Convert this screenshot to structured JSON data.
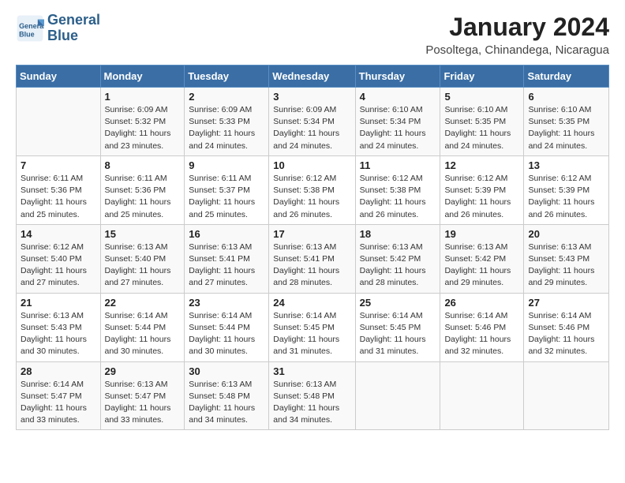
{
  "logo": {
    "line1": "General",
    "line2": "Blue"
  },
  "title": "January 2024",
  "subtitle": "Posoltega, Chinandega, Nicaragua",
  "header_days": [
    "Sunday",
    "Monday",
    "Tuesday",
    "Wednesday",
    "Thursday",
    "Friday",
    "Saturday"
  ],
  "weeks": [
    [
      {
        "day": "",
        "sunrise": "",
        "sunset": "",
        "daylight": ""
      },
      {
        "day": "1",
        "sunrise": "Sunrise: 6:09 AM",
        "sunset": "Sunset: 5:32 PM",
        "daylight": "Daylight: 11 hours and 23 minutes."
      },
      {
        "day": "2",
        "sunrise": "Sunrise: 6:09 AM",
        "sunset": "Sunset: 5:33 PM",
        "daylight": "Daylight: 11 hours and 24 minutes."
      },
      {
        "day": "3",
        "sunrise": "Sunrise: 6:09 AM",
        "sunset": "Sunset: 5:34 PM",
        "daylight": "Daylight: 11 hours and 24 minutes."
      },
      {
        "day": "4",
        "sunrise": "Sunrise: 6:10 AM",
        "sunset": "Sunset: 5:34 PM",
        "daylight": "Daylight: 11 hours and 24 minutes."
      },
      {
        "day": "5",
        "sunrise": "Sunrise: 6:10 AM",
        "sunset": "Sunset: 5:35 PM",
        "daylight": "Daylight: 11 hours and 24 minutes."
      },
      {
        "day": "6",
        "sunrise": "Sunrise: 6:10 AM",
        "sunset": "Sunset: 5:35 PM",
        "daylight": "Daylight: 11 hours and 24 minutes."
      }
    ],
    [
      {
        "day": "7",
        "sunrise": "Sunrise: 6:11 AM",
        "sunset": "Sunset: 5:36 PM",
        "daylight": "Daylight: 11 hours and 25 minutes."
      },
      {
        "day": "8",
        "sunrise": "Sunrise: 6:11 AM",
        "sunset": "Sunset: 5:36 PM",
        "daylight": "Daylight: 11 hours and 25 minutes."
      },
      {
        "day": "9",
        "sunrise": "Sunrise: 6:11 AM",
        "sunset": "Sunset: 5:37 PM",
        "daylight": "Daylight: 11 hours and 25 minutes."
      },
      {
        "day": "10",
        "sunrise": "Sunrise: 6:12 AM",
        "sunset": "Sunset: 5:38 PM",
        "daylight": "Daylight: 11 hours and 26 minutes."
      },
      {
        "day": "11",
        "sunrise": "Sunrise: 6:12 AM",
        "sunset": "Sunset: 5:38 PM",
        "daylight": "Daylight: 11 hours and 26 minutes."
      },
      {
        "day": "12",
        "sunrise": "Sunrise: 6:12 AM",
        "sunset": "Sunset: 5:39 PM",
        "daylight": "Daylight: 11 hours and 26 minutes."
      },
      {
        "day": "13",
        "sunrise": "Sunrise: 6:12 AM",
        "sunset": "Sunset: 5:39 PM",
        "daylight": "Daylight: 11 hours and 26 minutes."
      }
    ],
    [
      {
        "day": "14",
        "sunrise": "Sunrise: 6:12 AM",
        "sunset": "Sunset: 5:40 PM",
        "daylight": "Daylight: 11 hours and 27 minutes."
      },
      {
        "day": "15",
        "sunrise": "Sunrise: 6:13 AM",
        "sunset": "Sunset: 5:40 PM",
        "daylight": "Daylight: 11 hours and 27 minutes."
      },
      {
        "day": "16",
        "sunrise": "Sunrise: 6:13 AM",
        "sunset": "Sunset: 5:41 PM",
        "daylight": "Daylight: 11 hours and 27 minutes."
      },
      {
        "day": "17",
        "sunrise": "Sunrise: 6:13 AM",
        "sunset": "Sunset: 5:41 PM",
        "daylight": "Daylight: 11 hours and 28 minutes."
      },
      {
        "day": "18",
        "sunrise": "Sunrise: 6:13 AM",
        "sunset": "Sunset: 5:42 PM",
        "daylight": "Daylight: 11 hours and 28 minutes."
      },
      {
        "day": "19",
        "sunrise": "Sunrise: 6:13 AM",
        "sunset": "Sunset: 5:42 PM",
        "daylight": "Daylight: 11 hours and 29 minutes."
      },
      {
        "day": "20",
        "sunrise": "Sunrise: 6:13 AM",
        "sunset": "Sunset: 5:43 PM",
        "daylight": "Daylight: 11 hours and 29 minutes."
      }
    ],
    [
      {
        "day": "21",
        "sunrise": "Sunrise: 6:13 AM",
        "sunset": "Sunset: 5:43 PM",
        "daylight": "Daylight: 11 hours and 30 minutes."
      },
      {
        "day": "22",
        "sunrise": "Sunrise: 6:14 AM",
        "sunset": "Sunset: 5:44 PM",
        "daylight": "Daylight: 11 hours and 30 minutes."
      },
      {
        "day": "23",
        "sunrise": "Sunrise: 6:14 AM",
        "sunset": "Sunset: 5:44 PM",
        "daylight": "Daylight: 11 hours and 30 minutes."
      },
      {
        "day": "24",
        "sunrise": "Sunrise: 6:14 AM",
        "sunset": "Sunset: 5:45 PM",
        "daylight": "Daylight: 11 hours and 31 minutes."
      },
      {
        "day": "25",
        "sunrise": "Sunrise: 6:14 AM",
        "sunset": "Sunset: 5:45 PM",
        "daylight": "Daylight: 11 hours and 31 minutes."
      },
      {
        "day": "26",
        "sunrise": "Sunrise: 6:14 AM",
        "sunset": "Sunset: 5:46 PM",
        "daylight": "Daylight: 11 hours and 32 minutes."
      },
      {
        "day": "27",
        "sunrise": "Sunrise: 6:14 AM",
        "sunset": "Sunset: 5:46 PM",
        "daylight": "Daylight: 11 hours and 32 minutes."
      }
    ],
    [
      {
        "day": "28",
        "sunrise": "Sunrise: 6:14 AM",
        "sunset": "Sunset: 5:47 PM",
        "daylight": "Daylight: 11 hours and 33 minutes."
      },
      {
        "day": "29",
        "sunrise": "Sunrise: 6:13 AM",
        "sunset": "Sunset: 5:47 PM",
        "daylight": "Daylight: 11 hours and 33 minutes."
      },
      {
        "day": "30",
        "sunrise": "Sunrise: 6:13 AM",
        "sunset": "Sunset: 5:48 PM",
        "daylight": "Daylight: 11 hours and 34 minutes."
      },
      {
        "day": "31",
        "sunrise": "Sunrise: 6:13 AM",
        "sunset": "Sunset: 5:48 PM",
        "daylight": "Daylight: 11 hours and 34 minutes."
      },
      {
        "day": "",
        "sunrise": "",
        "sunset": "",
        "daylight": ""
      },
      {
        "day": "",
        "sunrise": "",
        "sunset": "",
        "daylight": ""
      },
      {
        "day": "",
        "sunrise": "",
        "sunset": "",
        "daylight": ""
      }
    ]
  ],
  "colors": {
    "header_bg": "#3a6ea5",
    "header_text": "#ffffff",
    "border": "#cccccc",
    "row_odd": "#f9f9f9",
    "row_even": "#ffffff"
  }
}
